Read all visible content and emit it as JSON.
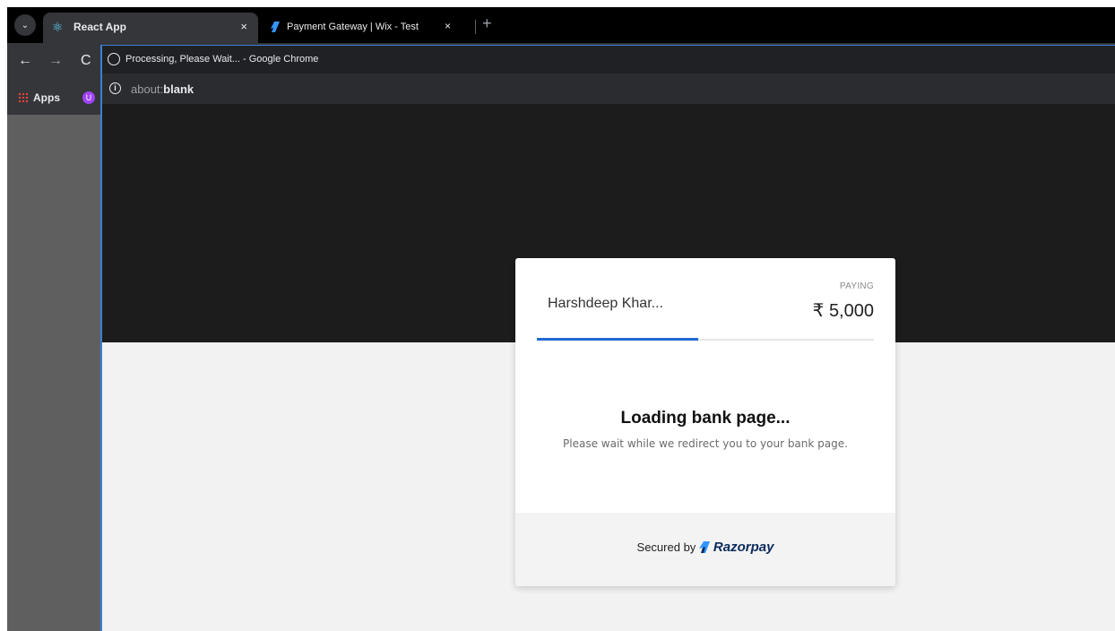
{
  "browser": {
    "tabs": [
      {
        "title": "React App",
        "active": true
      },
      {
        "title": "Payment Gateway | Wix - Test",
        "active": false
      }
    ],
    "close_glyph": "×",
    "new_tab_glyph": "+",
    "bookmarks": {
      "apps_label": "Apps"
    }
  },
  "popup": {
    "window_title": "Processing, Please Wait... - Google Chrome",
    "url_prefix": "about:",
    "url_main": "blank"
  },
  "checkout": {
    "merchant_name": "Harshdeep Khar...",
    "paying_label": "PAYING",
    "amount": "₹ 5,000",
    "progress_fraction": 0.48,
    "loading_title": "Loading bank page...",
    "loading_subtitle": "Please wait while we redirect you to your bank page.",
    "secured_by": "Secured by",
    "brand_name": "Razorpay",
    "accent_color": "#1f6bd1"
  }
}
